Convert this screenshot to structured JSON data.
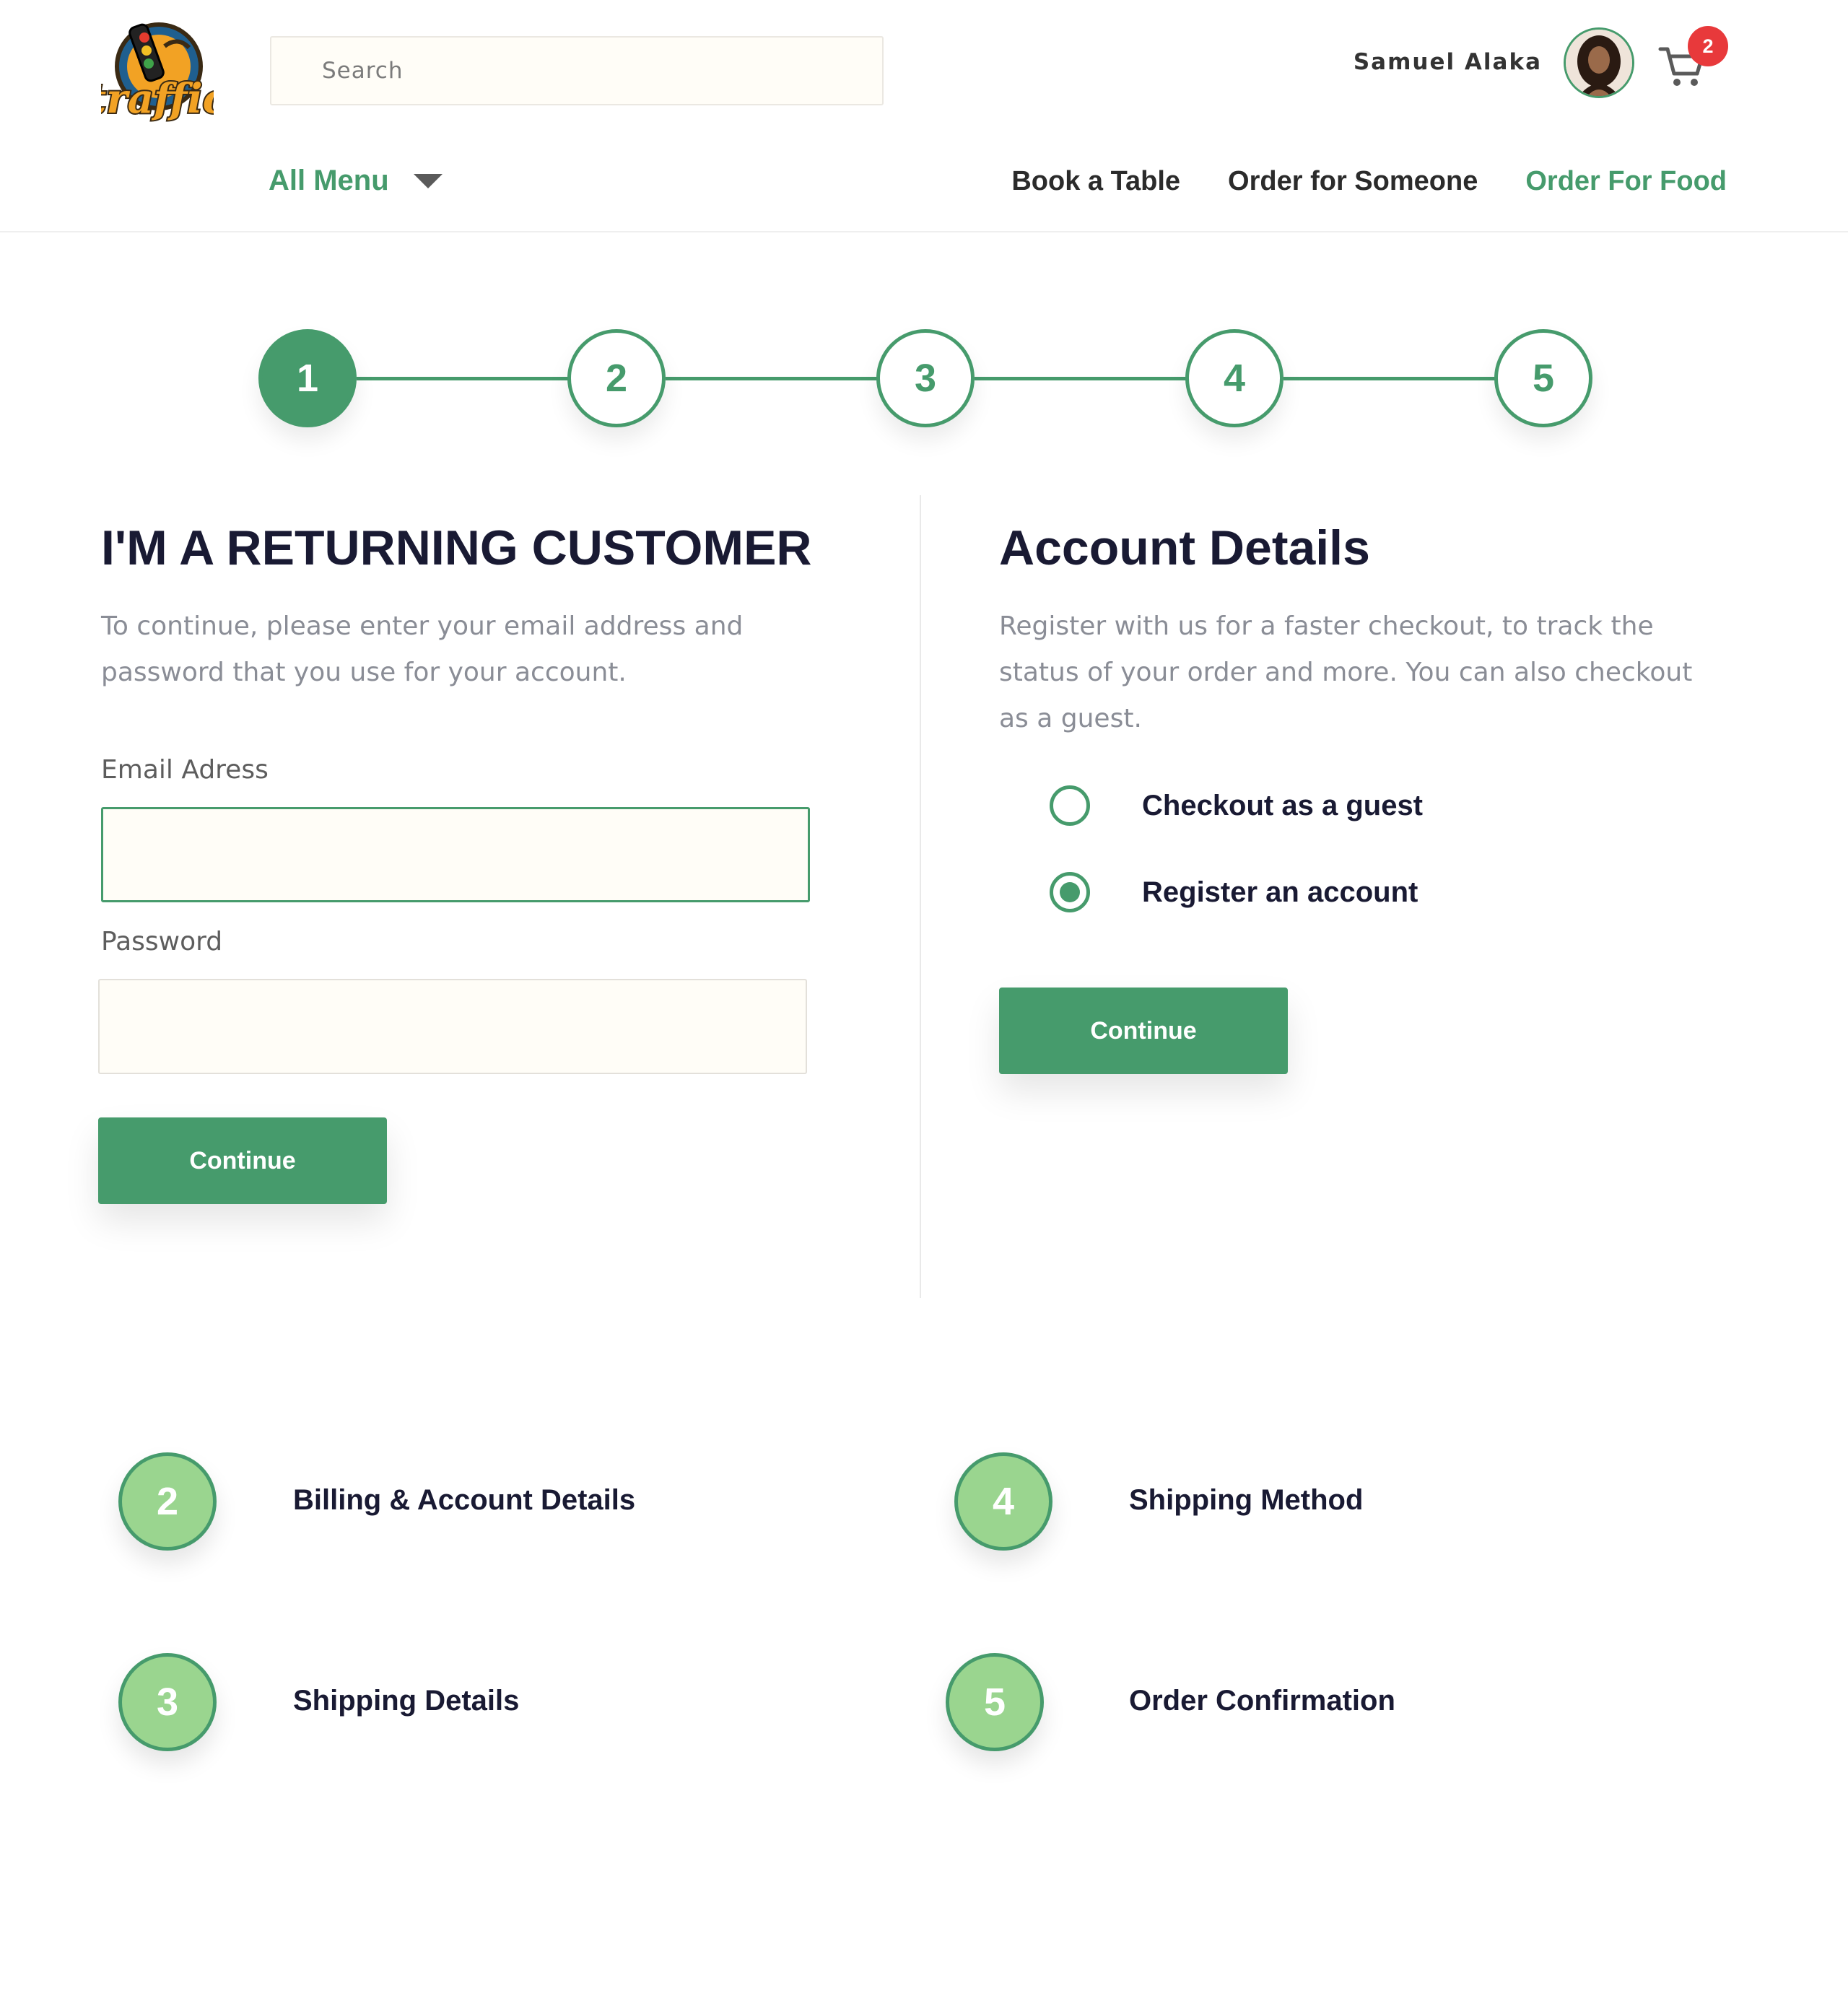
{
  "header": {
    "logo_text": "traffic",
    "search_placeholder": "Search",
    "user_name": "Samuel Alaka",
    "cart_count": "2"
  },
  "nav": {
    "all_menu": "All Menu",
    "links": [
      "Book a Table",
      "Order for Someone",
      "Order For Food"
    ],
    "active_link": "Order For Food"
  },
  "stepper": {
    "steps": [
      "1",
      "2",
      "3",
      "4",
      "5"
    ],
    "active_step": "1"
  },
  "returning": {
    "title": "I'M A RETURNING CUSTOMER",
    "description": "To continue, please enter your email address and password that you use for your account.",
    "email_label": "Email Adress",
    "email_value": "",
    "password_label": "Password",
    "password_value": "",
    "continue_label": "Continue"
  },
  "account": {
    "title": "Account Details",
    "description": "Register with us for a faster checkout, to track the status of your order and more. You can also checkout as a guest.",
    "options": [
      "Checkout as a guest",
      "Register an account"
    ],
    "selected_option": "Register an account",
    "continue_label": "Continue"
  },
  "upcoming_steps": [
    {
      "number": "2",
      "label": "Billing & Account Details"
    },
    {
      "number": "3",
      "label": "Shipping Details"
    },
    {
      "number": "4",
      "label": "Shipping Method"
    },
    {
      "number": "5",
      "label": "Order Confirmation"
    }
  ],
  "colors": {
    "accent": "#469b6c",
    "light_green": "#9ad58f",
    "badge_red": "#e8393b",
    "heading": "#191a33",
    "input_bg": "#fffdf7"
  }
}
